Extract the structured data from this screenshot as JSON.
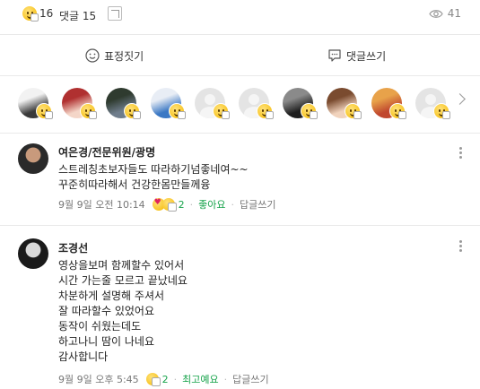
{
  "stats": {
    "emotion_icon": "smile-hand-emoji-icon",
    "emotion_count": "16",
    "comment_label": "댓글 15",
    "share_icon": "share-icon",
    "view_icon": "eye-icon",
    "view_count": "41"
  },
  "actions": {
    "react_label": "표정짓기",
    "react_icon": "smile-outline-icon",
    "comment_label": "댓글쓰기",
    "comment_icon": "speech-bubble-icon"
  },
  "reactors": {
    "badge_icon": "smile-hand-emoji-icon",
    "next_icon": "chevron-right-icon",
    "items": [
      {
        "avatar_colors": [
          "#3a3a3a",
          "#f2f2f2"
        ]
      },
      {
        "avatar_colors": [
          "#f4d6c8",
          "#b03030"
        ]
      },
      {
        "avatar_colors": [
          "#6f7d8c",
          "#2f3b2f"
        ]
      },
      {
        "avatar_colors": [
          "#3b78c4",
          "#e8edf5"
        ]
      },
      {
        "avatar_colors": null
      },
      {
        "avatar_colors": null
      },
      {
        "avatar_colors": [
          "#1e1e1e",
          "#8a8a8a"
        ]
      },
      {
        "avatar_colors": [
          "#f1d3bd",
          "#7a4b2f"
        ]
      },
      {
        "avatar_colors": [
          "#c0472e",
          "#e8a24a"
        ]
      },
      {
        "avatar_colors": null
      }
    ]
  },
  "comments": [
    {
      "author": "여은경/전문위원/광명",
      "body": "스트레칭초보자들도  따라하기넘좋네여~~\n꾸준히따라해서 건강한몸만들께융",
      "time": "9월 9일 오전 10:14",
      "emotions": [
        "heart",
        "hand"
      ],
      "emotion_count": "2",
      "like_label": "좋아요",
      "reply_label": "답글쓰기",
      "avatar_colors": [
        "#2a2a2a",
        "#c89a7c"
      ]
    },
    {
      "author": "조경선",
      "body": "영상을보며 함께할수 있어서\n시간 가는줄 모르고 끝났네요\n차분하게 설명해 주셔서\n잘 따라할수 있었어요\n동작이 쉬웠는데도\n하고나니  땀이 나네요\n감사합니다",
      "time": "9월 9일 오후 5:45",
      "emotions": [
        "hand"
      ],
      "emotion_count": "2",
      "like_label": "최고예요",
      "reply_label": "답글쓰기",
      "avatar_colors": [
        "#1a1a1a",
        "#d9d9d9"
      ]
    }
  ],
  "colors": {
    "accent_green": "#16a34a",
    "divider": "#e9e9e9",
    "muted_text": "#777777"
  }
}
